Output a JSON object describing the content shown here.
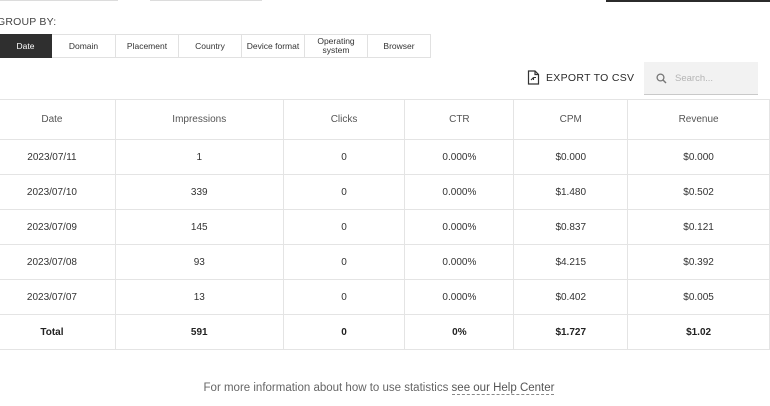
{
  "group_by": {
    "label": "GROUP BY:",
    "tabs": [
      {
        "label": "Date",
        "active": true
      },
      {
        "label": "Domain",
        "active": false
      },
      {
        "label": "Placement",
        "active": false
      },
      {
        "label": "Country",
        "active": false
      },
      {
        "label": "Device format",
        "active": false
      },
      {
        "label": "Operating system",
        "active": false
      },
      {
        "label": "Browser",
        "active": false
      }
    ]
  },
  "toolbar": {
    "export_label": "EXPORT TO CSV",
    "search_placeholder": "Search...",
    "search_value": ""
  },
  "table": {
    "columns": [
      "Date",
      "Impressions",
      "Clicks",
      "CTR",
      "CPM",
      "Revenue"
    ],
    "rows": [
      [
        "2023/07/11",
        "1",
        "0",
        "0.000%",
        "$0.000",
        "$0.000"
      ],
      [
        "2023/07/10",
        "339",
        "0",
        "0.000%",
        "$1.480",
        "$0.502"
      ],
      [
        "2023/07/09",
        "145",
        "0",
        "0.000%",
        "$0.837",
        "$0.121"
      ],
      [
        "2023/07/08",
        "93",
        "0",
        "0.000%",
        "$4.215",
        "$0.392"
      ],
      [
        "2023/07/07",
        "13",
        "0",
        "0.000%",
        "$0.402",
        "$0.005"
      ]
    ],
    "total": [
      "Total",
      "591",
      "0",
      "0%",
      "$1.727",
      "$1.02"
    ]
  },
  "footer": {
    "text": "For more information about how to use statistics",
    "link": "see our Help Center"
  },
  "colors": {
    "active_tab": "#2f2f2f",
    "border": "#e4e4e4",
    "search_bg": "#f2f2f2"
  }
}
